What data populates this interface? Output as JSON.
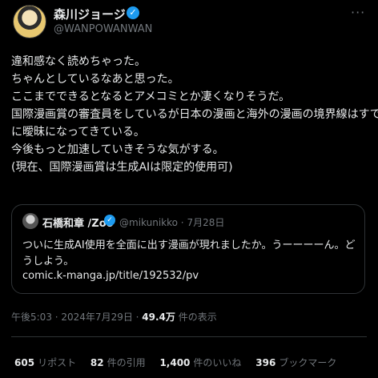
{
  "author": {
    "display_name": "森川ジョージ",
    "handle": "@WANPOWANWAN",
    "verified_icon": "verified-badge-icon"
  },
  "more_label": "···",
  "body": [
    "違和感なく読めちゃった。",
    "ちゃんとしているなあと思った。",
    "ここまでできるとなるとアメコミとか凄くなりそうだ。",
    "国際漫画賞の審査員をしているが日本の漫画と海外の漫画の境界線はすで",
    "に曖昧になってきている。",
    "今後もっと加速していきそうな気がする。",
    "(現在、国際漫画賞は生成AIは限定的使用可)"
  ],
  "quote": {
    "display_name": "石橋和章 /Zoo",
    "handle": "@mikunikko",
    "separator": "·",
    "date": "7月28日",
    "text": "ついに生成AI使用を全面に出す漫画が現れましたか。うーーーーん。どうしよう。",
    "link": "comic.k-manga.jp/title/192532/pv"
  },
  "meta": {
    "time": "午後5:03 · 2024年7月29日 · ",
    "views_count": "49.4万",
    "views_label": " 件の表示"
  },
  "stats": {
    "reposts_count": "605",
    "reposts_label": "リポスト",
    "quotes_count": "82",
    "quotes_label": "件の引用",
    "likes_count": "1,400",
    "likes_label": "件のいいね",
    "bookmarks_count": "396",
    "bookmarks_label": "ブックマーク"
  },
  "colors": {
    "background": "#000000",
    "text": "#e7e9ea",
    "muted": "#71767b",
    "accent": "#1d9bf0",
    "border": "#2f3336"
  }
}
